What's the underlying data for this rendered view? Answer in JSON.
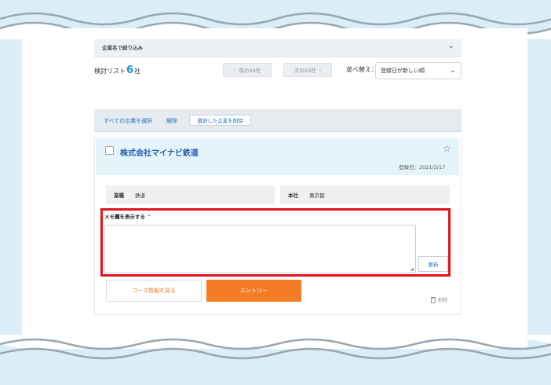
{
  "filter": {
    "label": "企業名で絞り込み"
  },
  "count": {
    "prefix": "検討リスト",
    "num": "6",
    "suffix": "社"
  },
  "pagination": {
    "prev": "前の50社",
    "next": "次の50社",
    "prev_arrow": "‹",
    "next_arrow": "›"
  },
  "sort": {
    "label": "並べ替え：",
    "value": "登録日が新しい順"
  },
  "actions": {
    "select_all": "すべての企業を選択",
    "unselect": "解除",
    "delete_selected": "選択した企業を削除"
  },
  "card": {
    "company": "株式会社マイナビ鉄道",
    "reg_date": "登録日：2021/2/17",
    "industry_label": "業種",
    "industry_value": "鉄道",
    "hq_label": "本社",
    "hq_value": "東京都",
    "memo_title": "メモ欄を表示する",
    "memo_value": "",
    "update": "更新",
    "course": "コース情報を見る",
    "entry": "エントリー",
    "delete": "削除"
  },
  "colors": {
    "accent_blue": "#1f8fd6",
    "entry_orange": "#f47c24",
    "highlight_red": "#e0141e"
  },
  "icons": {
    "chevron": "chevron-down-icon",
    "star": "star-icon",
    "trash": "trash-icon"
  }
}
